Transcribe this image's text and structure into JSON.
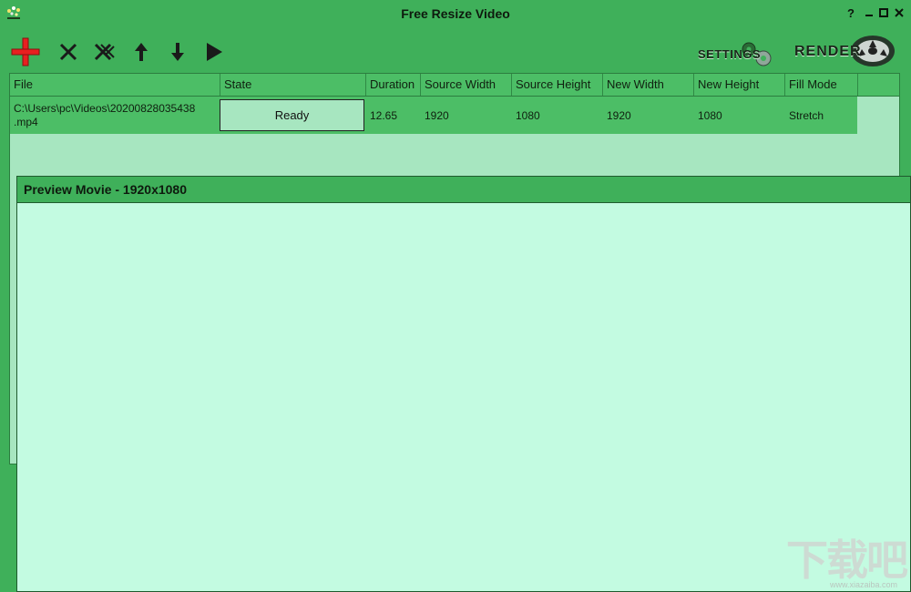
{
  "window": {
    "title": "Free Resize Video",
    "controls": {
      "help": "?",
      "minimize": "▬",
      "maximize": "▣",
      "close": "✕"
    }
  },
  "toolbar": {
    "buttons": [
      {
        "name": "add-button",
        "icon": "plus-icon"
      },
      {
        "name": "remove-button",
        "icon": "close-icon"
      },
      {
        "name": "clear-all-button",
        "icon": "clear-icon"
      },
      {
        "name": "move-up-button",
        "icon": "arrow-up-icon"
      },
      {
        "name": "move-down-button",
        "icon": "arrow-down-icon"
      },
      {
        "name": "play-button",
        "icon": "play-icon"
      }
    ],
    "settings_label": "SETTINGS",
    "render_label": "RENDER"
  },
  "list": {
    "columns": [
      "File",
      "State",
      "Duration",
      "Source Width",
      "Source Height",
      "New Width",
      "New Height",
      "Fill Mode"
    ],
    "rows": [
      {
        "file_line1": "C:\\Users\\pc\\Videos\\20200828035438",
        "file_line2": ".mp4",
        "state": "Ready",
        "duration": "12.65",
        "source_width": "1920",
        "source_height": "1080",
        "new_width": "1920",
        "new_height": "1080",
        "fill_mode": "Stretch"
      }
    ]
  },
  "preview": {
    "title": "Preview Movie - 1920x1080"
  },
  "watermark": {
    "text": "下载吧",
    "sub": "www.xiazaiba.com"
  },
  "colors": {
    "background": "#3fb05a",
    "header": "#4cbe66",
    "list_bg": "#a7e6c0",
    "preview_bg": "#c3fbe1",
    "add_icon": "#e82020"
  }
}
